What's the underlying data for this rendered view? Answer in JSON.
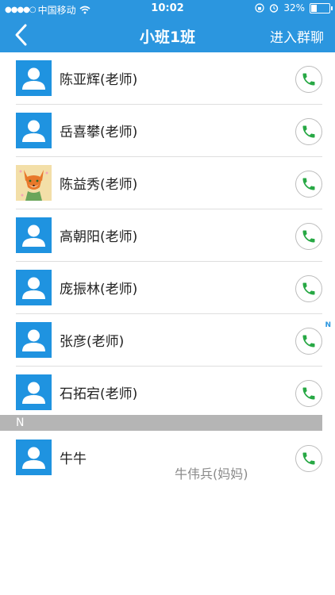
{
  "status": {
    "carrier": "中国移动",
    "time": "10:02",
    "battery": "32%",
    "battery_level": 0.32
  },
  "nav": {
    "title": "小班1班",
    "join_label": "进入群聊"
  },
  "teachers": [
    {
      "name": "陈亚辉(老师)"
    },
    {
      "name": "岳喜攀(老师)"
    },
    {
      "name": "陈益秀(老师)"
    },
    {
      "name": "高朝阳(老师)"
    },
    {
      "name": "庞振林(老师)"
    },
    {
      "name": "张彦(老师)"
    },
    {
      "name": "石拓宕(老师)"
    }
  ],
  "section_n": {
    "header": "N",
    "index_letter": "N"
  },
  "student": {
    "name": "牛牛",
    "parent": "牛伟兵(妈妈)"
  },
  "colors": {
    "brand": "#2b96df",
    "phone_green": "#27a844"
  },
  "icons": {
    "back": "chevron-left-icon",
    "phone": "phone-icon",
    "avatar": "person-avatar-icon"
  }
}
